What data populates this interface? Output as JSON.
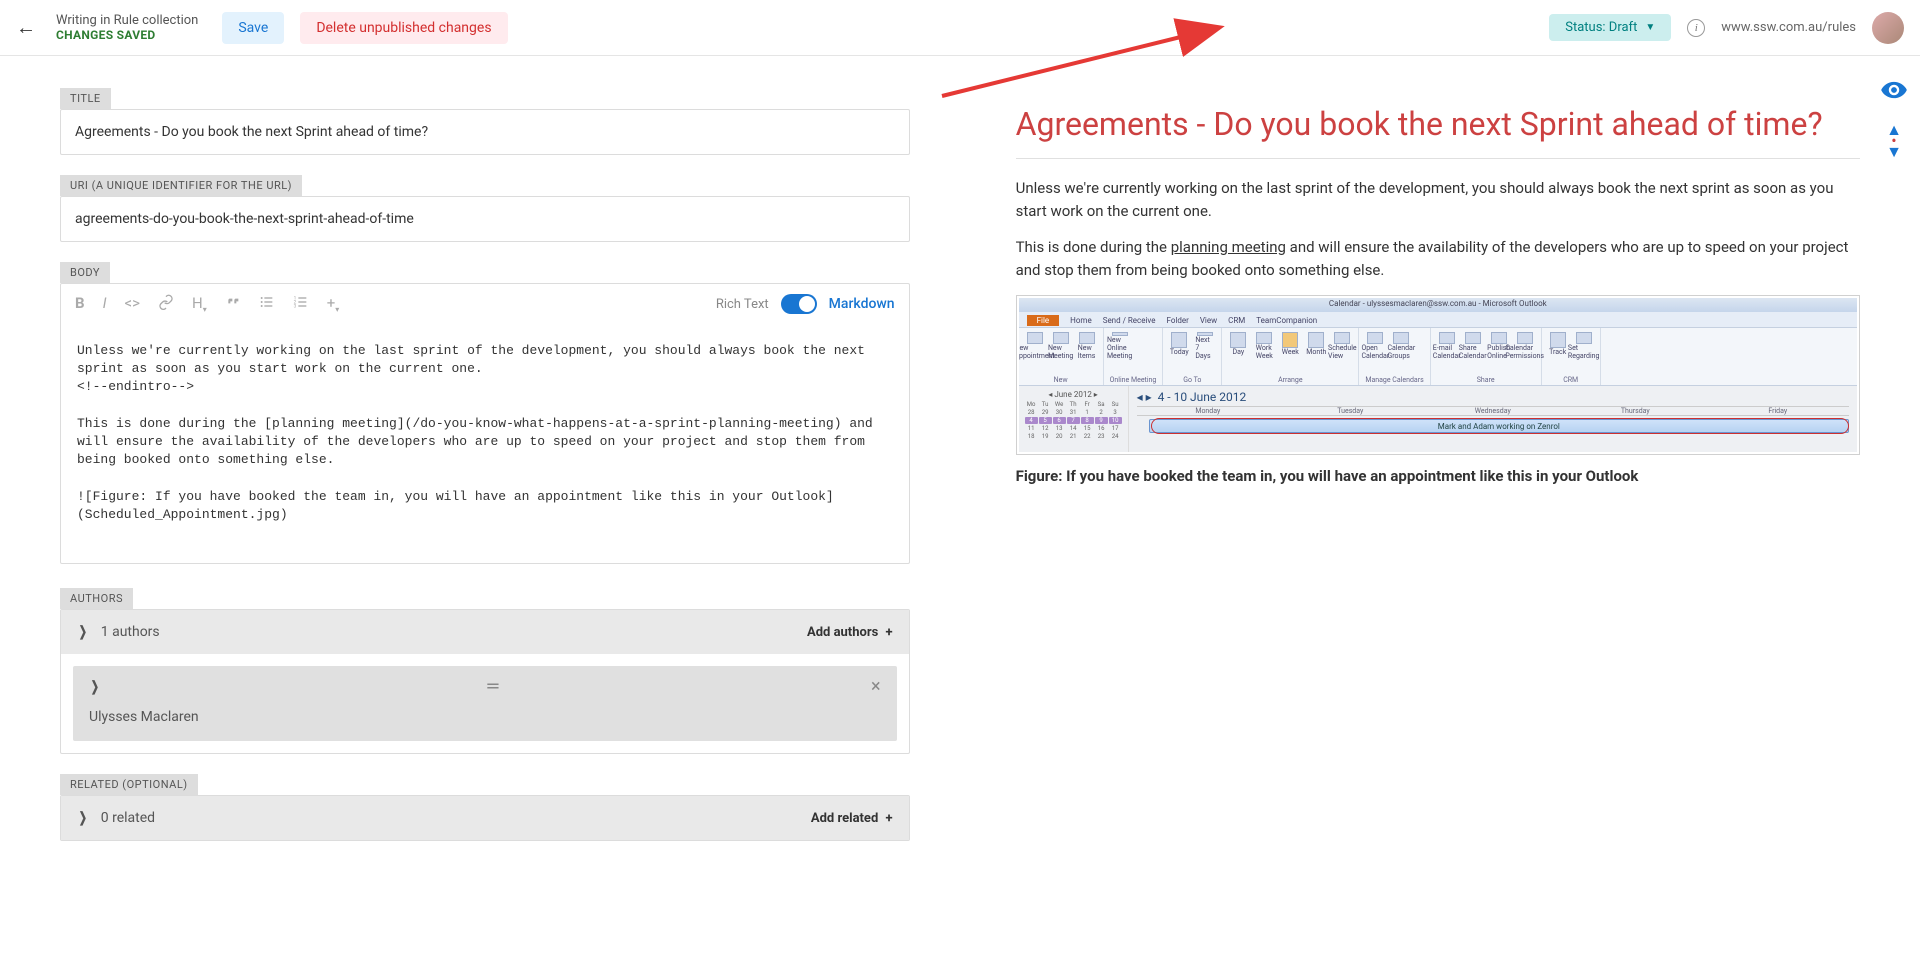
{
  "topbar": {
    "context_line": "Writing in Rule collection",
    "saved_label": "CHANGES SAVED",
    "save_label": "Save",
    "delete_label": "Delete unpublished changes",
    "status_label": "Status: Draft",
    "url_display": "www.ssw.com.au/rules"
  },
  "form": {
    "title_label": "TITLE",
    "title_value": "Agreements - Do you book the next Sprint ahead of time?",
    "uri_label": "URI (A UNIQUE IDENTIFIER FOR THE URL)",
    "uri_value": "agreements-do-you-book-the-next-sprint-ahead-of-time",
    "body_label": "BODY",
    "richtext_label": "Rich Text",
    "markdown_label": "Markdown",
    "body_value": "Unless we're currently working on the last sprint of the development, you should always book the next sprint as soon as you start work on the current one.\n<!--endintro-->\n\nThis is done during the [planning meeting](/do-you-know-what-happens-at-a-sprint-planning-meeting) and will ensure the availability of the developers who are up to speed on your project and stop them from being booked onto something else.\n\n![Figure: If you have booked the team in, you will have an appointment like this in your Outlook](Scheduled_Appointment.jpg)",
    "authors_label": "AUTHORS",
    "authors_summary": "1 authors",
    "add_authors_label": "Add authors",
    "author_name": "Ulysses Maclaren",
    "related_label": "RELATED (OPTIONAL)",
    "related_summary": "0 related",
    "add_related_label": "Add related"
  },
  "preview": {
    "title": "Agreements - Do you book the next Sprint ahead of time?",
    "para1": "Unless we're currently working on the last sprint of the development, you should always book the next sprint as soon as you start work on the current one.",
    "para2_pre": "This is done during the ",
    "para2_link": "planning meeting",
    "para2_post": " and will ensure the availability of the developers who are up to speed on your project and stop them from being booked onto something else.",
    "figure_caption": "Figure: If you have booked the team in, you will have an appointment like this in your Outlook",
    "outlook": {
      "titlebar": "Calendar - ulyssesmaclaren@ssw.com.au - Microsoft Outlook",
      "tabs": [
        "File",
        "Home",
        "Send / Receive",
        "Folder",
        "View",
        "CRM",
        "TeamCompanion"
      ],
      "ribbon_groups": [
        "New",
        "Online Meeting",
        "Go To",
        "Arrange",
        "Manage Calendars",
        "Share",
        "CRM"
      ],
      "mini_month": "June 2012",
      "date_range": "4 - 10 June 2012",
      "days": [
        "Monday",
        "Tuesday",
        "Wednesday",
        "Thursday",
        "Friday"
      ],
      "event": "Mark and Adam working on Zenrol"
    }
  }
}
